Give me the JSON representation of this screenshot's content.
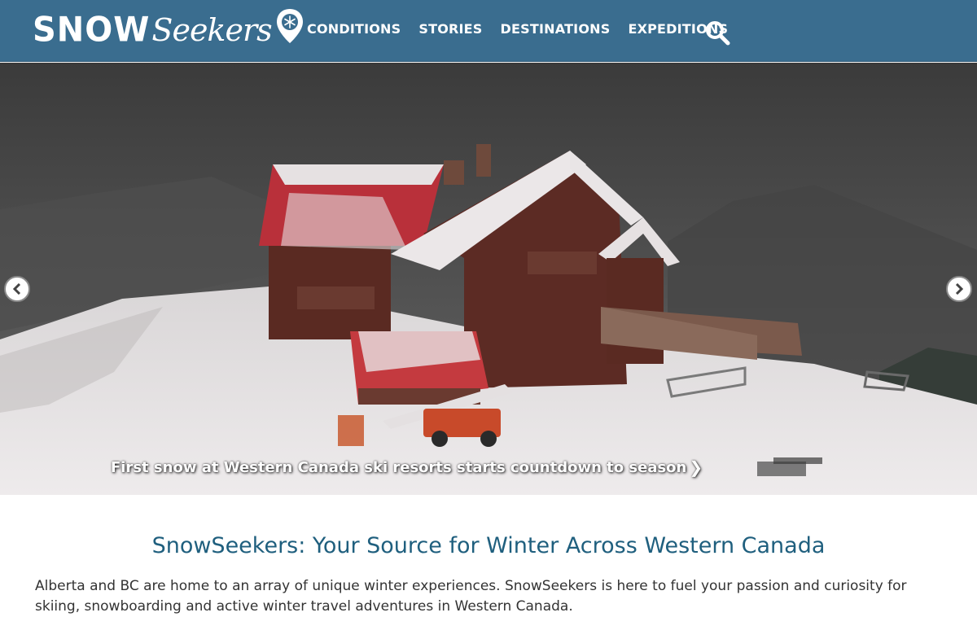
{
  "brand": {
    "logo_snow": "SNOW",
    "logo_seekers": "Seekers"
  },
  "nav": {
    "items": [
      "CONDITIONS",
      "STORIES",
      "DESTINATIONS",
      "EXPEDITIONS"
    ]
  },
  "header": {
    "bg_color": "#3a6d8f"
  },
  "hero": {
    "caption": "First snow at Western Canada ski resorts starts countdown to season",
    "caption_chevron": "❯",
    "prev_icon": "chevron-left-icon",
    "next_icon": "chevron-right-icon"
  },
  "intro": {
    "title": "SnowSeekers: Your Source for Winter Across Western Canada",
    "title_color": "#1f5f7e",
    "text": "Alberta and BC are home to an array of unique winter experiences. SnowSeekers is here to fuel your passion and curiosity for skiing, snowboarding and active winter travel adventures in Western Canada."
  }
}
